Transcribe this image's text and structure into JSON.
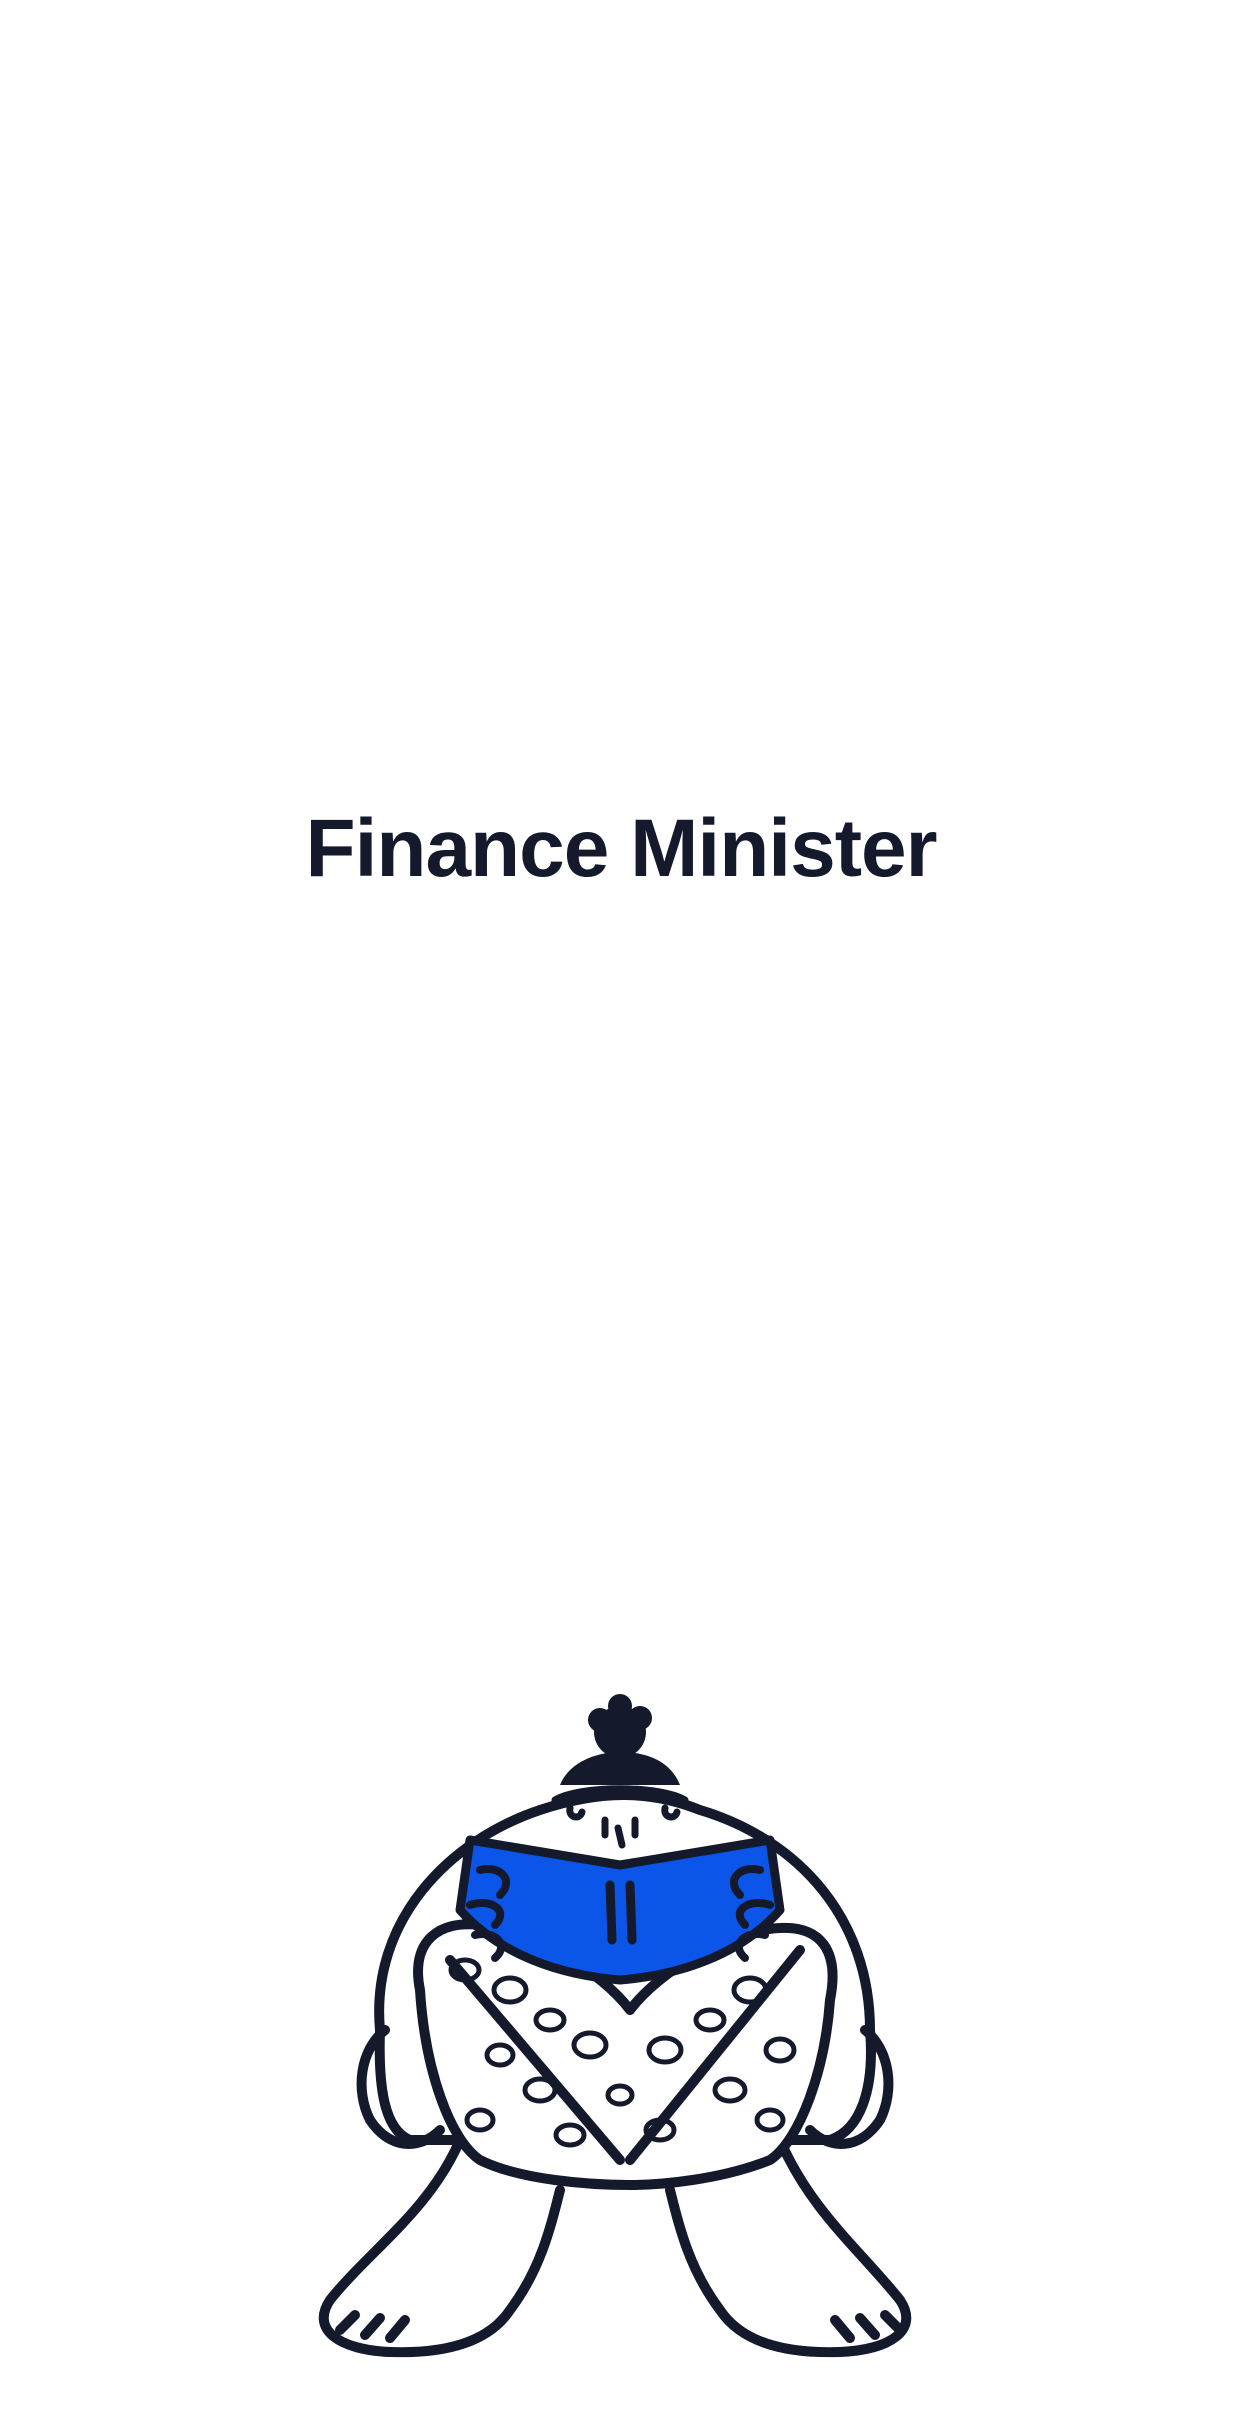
{
  "screen": {
    "title": "Finance Minister"
  },
  "illustration": {
    "icon": "character-reading-book-illustration",
    "ink_color": "#141a2b",
    "accent_color": "#0b55e8"
  }
}
